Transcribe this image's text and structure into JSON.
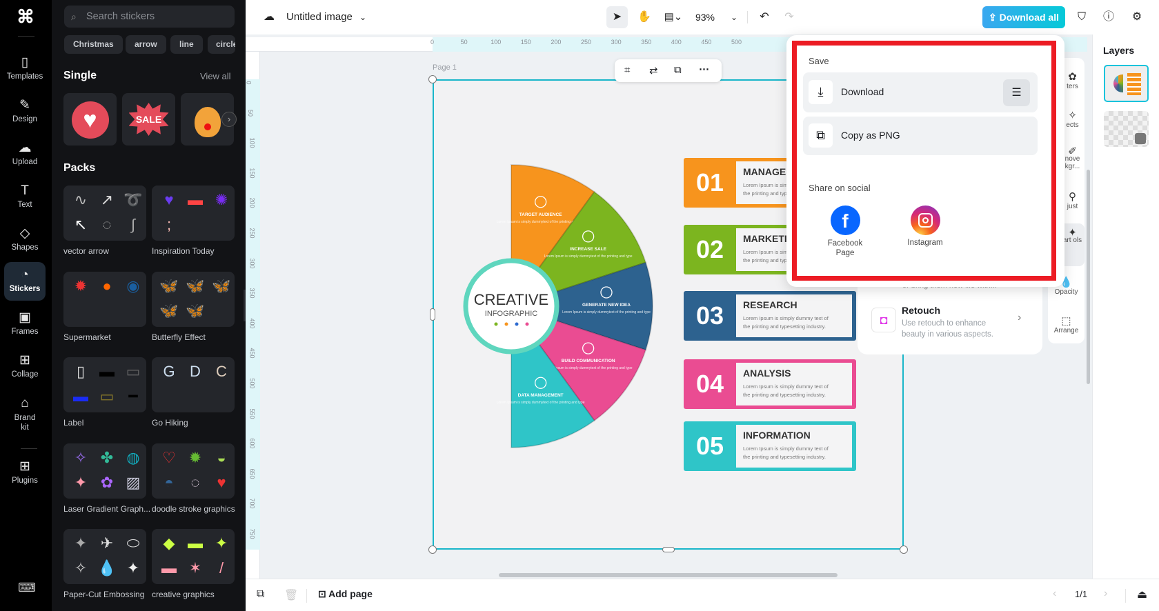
{
  "nav": {
    "items": [
      {
        "label": "Templates",
        "icon": "templates-icon"
      },
      {
        "label": "Design",
        "icon": "design-icon"
      },
      {
        "label": "Upload",
        "icon": "upload-icon"
      },
      {
        "label": "Text",
        "icon": "text-icon"
      },
      {
        "label": "Shapes",
        "icon": "shapes-icon"
      },
      {
        "label": "Stickers",
        "icon": "stickers-icon",
        "active": true
      },
      {
        "label": "Frames",
        "icon": "frames-icon"
      },
      {
        "label": "Collage",
        "icon": "collage-icon"
      },
      {
        "label": "Brand kit",
        "icon": "brand-kit-icon"
      },
      {
        "label": "Plugins",
        "icon": "plugins-icon"
      }
    ]
  },
  "stickers": {
    "search_placeholder": "Search stickers",
    "chips": [
      "Christmas",
      "arrow",
      "line",
      "circle"
    ],
    "single_title": "Single",
    "view_all": "View all",
    "single_items": [
      "heart",
      "SALE",
      "reindeer"
    ],
    "packs_title": "Packs",
    "packs": [
      "vector arrow",
      "Inspiration Today",
      "Supermarket",
      "Butterfly Effect",
      "Label",
      "Go Hiking",
      "Laser Gradient Graph...",
      "doodle stroke graphics",
      "Paper-Cut Embossing",
      "creative graphics"
    ]
  },
  "topbar": {
    "title": "Untitled image",
    "zoom": "93%",
    "download_all": "Download all",
    "accent": "#1fc3dc"
  },
  "ruler": {
    "h": [
      "0",
      "50",
      "100",
      "150",
      "200",
      "250",
      "300",
      "350",
      "400",
      "450",
      "500"
    ],
    "v": [
      "0",
      "50",
      "100",
      "150",
      "200",
      "250",
      "300",
      "350",
      "400",
      "450",
      "500",
      "550",
      "600",
      "650",
      "700",
      "750"
    ]
  },
  "canvas": {
    "page_label": "Page 1",
    "infographic": {
      "center_title": "CREATIVE",
      "center_subtitle": "INFOGRAPHIC",
      "sectors": [
        {
          "title": "TARGET AUDIENCE",
          "text": "Lorem Ipsum is simply dummytext of the printing and type",
          "color": "#f7941d"
        },
        {
          "title": "INCREASE SALE",
          "text": "Lorem Ipsum is simply dummytext of the printing and type",
          "color": "#7cb51f"
        },
        {
          "title": "GENERATE NEW IDEA",
          "text": "Lorem Ipsum is simply dummytext of the printing and type",
          "color": "#2d628f"
        },
        {
          "title": "BUILD COMMUNICATION",
          "text": "Lorem Ipsum is simply dummytext of the printing and type",
          "color": "#ea4c92"
        },
        {
          "title": "DATA MANAGEMENT",
          "text": "Lorem Ipsum is simply dummytext of the printing and type",
          "color": "#2fc5c8"
        }
      ],
      "boxes": [
        {
          "num": "01",
          "title": "MANAGEMENT",
          "line1": "Lorem Ipsum is simply dummy text of",
          "line2": "the printing and typesetting industry.",
          "color": "#f7941d"
        },
        {
          "num": "02",
          "title": "MARKETING",
          "line1": "Lorem Ipsum is simply dummy text of",
          "line2": "the printing and typesetting industry.",
          "color": "#7cb51f"
        },
        {
          "num": "03",
          "title": "RESEARCH",
          "line1": "Lorem Ipsum is simply dummy text of",
          "line2": "the printing and typesetting industry.",
          "color": "#2d628f"
        },
        {
          "num": "04",
          "title": "ANALYSIS",
          "line1": "Lorem Ipsum is simply dummy text of",
          "line2": "the printing and typesetting industry.",
          "color": "#ea4c92"
        },
        {
          "num": "05",
          "title": "INFORMATION",
          "line1": "Lorem Ipsum is simply dummy text of",
          "line2": "the printing and typesetting industry.",
          "color": "#2fc5c8"
        }
      ]
    }
  },
  "popup": {
    "save_title": "Save",
    "download": "Download",
    "copy_png": "Copy as PNG",
    "share_title": "Share on social",
    "facebook": "Facebook Page",
    "instagram": "Instagram",
    "highlight_color": "#ec1c24"
  },
  "tools_panel": {
    "hidden_text": "or bring them new life with...",
    "retouch_title": "Retouch",
    "retouch_desc": "Use retouch to enhance beauty in various aspects.",
    "tools": [
      "ters",
      "ects",
      "nove kgr...",
      "just",
      "art ols",
      "Opacity",
      "Arrange"
    ]
  },
  "layers": {
    "title": "Layers"
  },
  "bottom": {
    "add_page": "Add page",
    "page_count": "1/1"
  }
}
